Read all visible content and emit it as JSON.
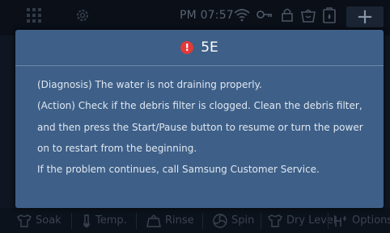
{
  "status_bar": {
    "time": "PM 07:57",
    "add_label": "+",
    "icons": [
      "grid-icon",
      "gear-icon",
      "wifi-icon",
      "key-icon",
      "lock-icon",
      "basket-icon",
      "dispenser-icon"
    ]
  },
  "dialog": {
    "code": "5E",
    "lines": [
      "(Diagnosis) The water is not draining properly.",
      "(Action) Check if the debris filter is clogged. Clean the debris filter,",
      "and then press the Start/Pause button to resume or turn the power",
      "on to restart from the beginning.",
      "If the problem continues, call Samsung Customer Service."
    ],
    "colors": {
      "background": "#3e5f87",
      "warning": "#e23a3a"
    }
  },
  "bottom_bar": {
    "soak": "Soak",
    "temp": "Temp.",
    "rinse": "Rinse",
    "spin": "Spin",
    "dry_level": "Dry Level",
    "options": "Options"
  }
}
